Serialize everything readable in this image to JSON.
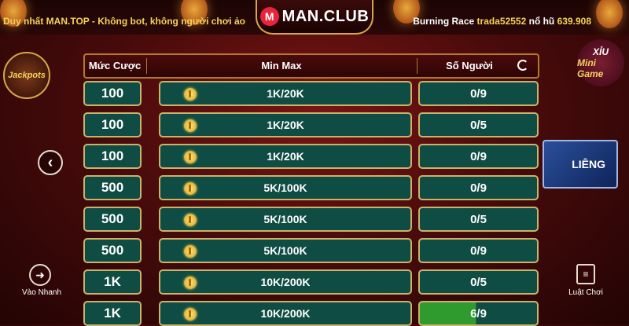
{
  "top": {
    "notice": "Duy nhất MAN.TOP - Không bot, không người chơi ảo",
    "logo": "MAN.CLUB",
    "logo_mark": "M",
    "burning_label": "Burning Race",
    "user": "trada52552",
    "jackpot_label": "nổ hũ",
    "jackpot_amount": "639.908"
  },
  "side": {
    "jackpots_label": "Jackpots",
    "mini_game_top": "XỈU",
    "mini_game_label": "Mini Game",
    "quick_join": "Vào Nhanh",
    "rules": "Luật Chơi",
    "lieng": "LIÊNG"
  },
  "table": {
    "headers": {
      "bet": "Mức Cược",
      "range": "Min Max",
      "players": "Số Người"
    },
    "rows": [
      {
        "bet": "100",
        "range": "1K/20K",
        "players": "0/9"
      },
      {
        "bet": "100",
        "range": "1K/20K",
        "players": "0/5"
      },
      {
        "bet": "100",
        "range": "1K/20K",
        "players": "0/9"
      },
      {
        "bet": "500",
        "range": "5K/100K",
        "players": "0/9"
      },
      {
        "bet": "500",
        "range": "5K/100K",
        "players": "0/5"
      },
      {
        "bet": "500",
        "range": "5K/100K",
        "players": "0/9"
      },
      {
        "bet": "1K",
        "range": "10K/200K",
        "players": "0/5"
      },
      {
        "bet": "1K",
        "range": "10K/200K",
        "players": "6/9"
      }
    ]
  },
  "colors": {
    "accent_gold": "#f4d35a",
    "row_green": "#0f4c43",
    "active_green": "#2f9a2e",
    "header_red": "#4c0a0a"
  }
}
